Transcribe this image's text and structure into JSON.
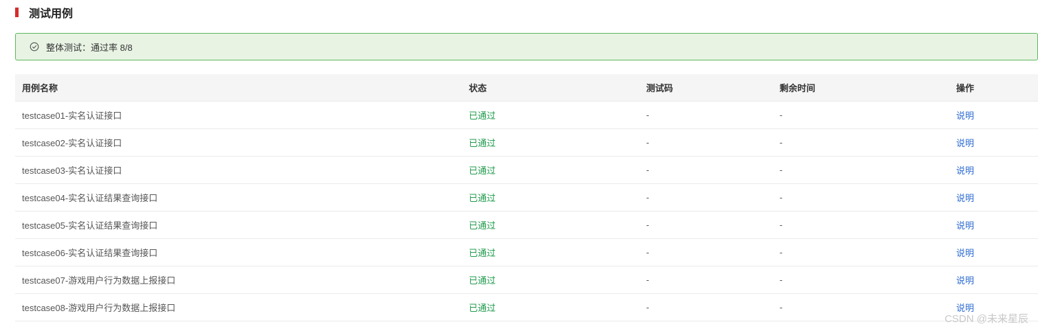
{
  "section": {
    "title": "测试用例",
    "accent_color": "#d62b2b"
  },
  "summary": {
    "icon": "check-circle-icon",
    "text": "整体测试：通过率 8/8",
    "bg_color": "#e8f3e4",
    "border_color": "#5cb85c"
  },
  "table": {
    "columns": [
      "用例名称",
      "状态",
      "测试码",
      "剩余时间",
      "操作"
    ],
    "status_color": "#1f9a4b",
    "link_color": "#2c6bd1",
    "rows": [
      {
        "name": "testcase01-实名认证接口",
        "status": "已通过",
        "code": "-",
        "remaining": "-",
        "action": "说明"
      },
      {
        "name": "testcase02-实名认证接口",
        "status": "已通过",
        "code": "-",
        "remaining": "-",
        "action": "说明"
      },
      {
        "name": "testcase03-实名认证接口",
        "status": "已通过",
        "code": "-",
        "remaining": "-",
        "action": "说明"
      },
      {
        "name": "testcase04-实名认证结果查询接口",
        "status": "已通过",
        "code": "-",
        "remaining": "-",
        "action": "说明"
      },
      {
        "name": "testcase05-实名认证结果查询接口",
        "status": "已通过",
        "code": "-",
        "remaining": "-",
        "action": "说明"
      },
      {
        "name": "testcase06-实名认证结果查询接口",
        "status": "已通过",
        "code": "-",
        "remaining": "-",
        "action": "说明"
      },
      {
        "name": "testcase07-游戏用户行为数据上报接口",
        "status": "已通过",
        "code": "-",
        "remaining": "-",
        "action": "说明"
      },
      {
        "name": "testcase08-游戏用户行为数据上报接口",
        "status": "已通过",
        "code": "-",
        "remaining": "-",
        "action": "说明"
      }
    ]
  },
  "watermark": "CSDN @未来星辰"
}
